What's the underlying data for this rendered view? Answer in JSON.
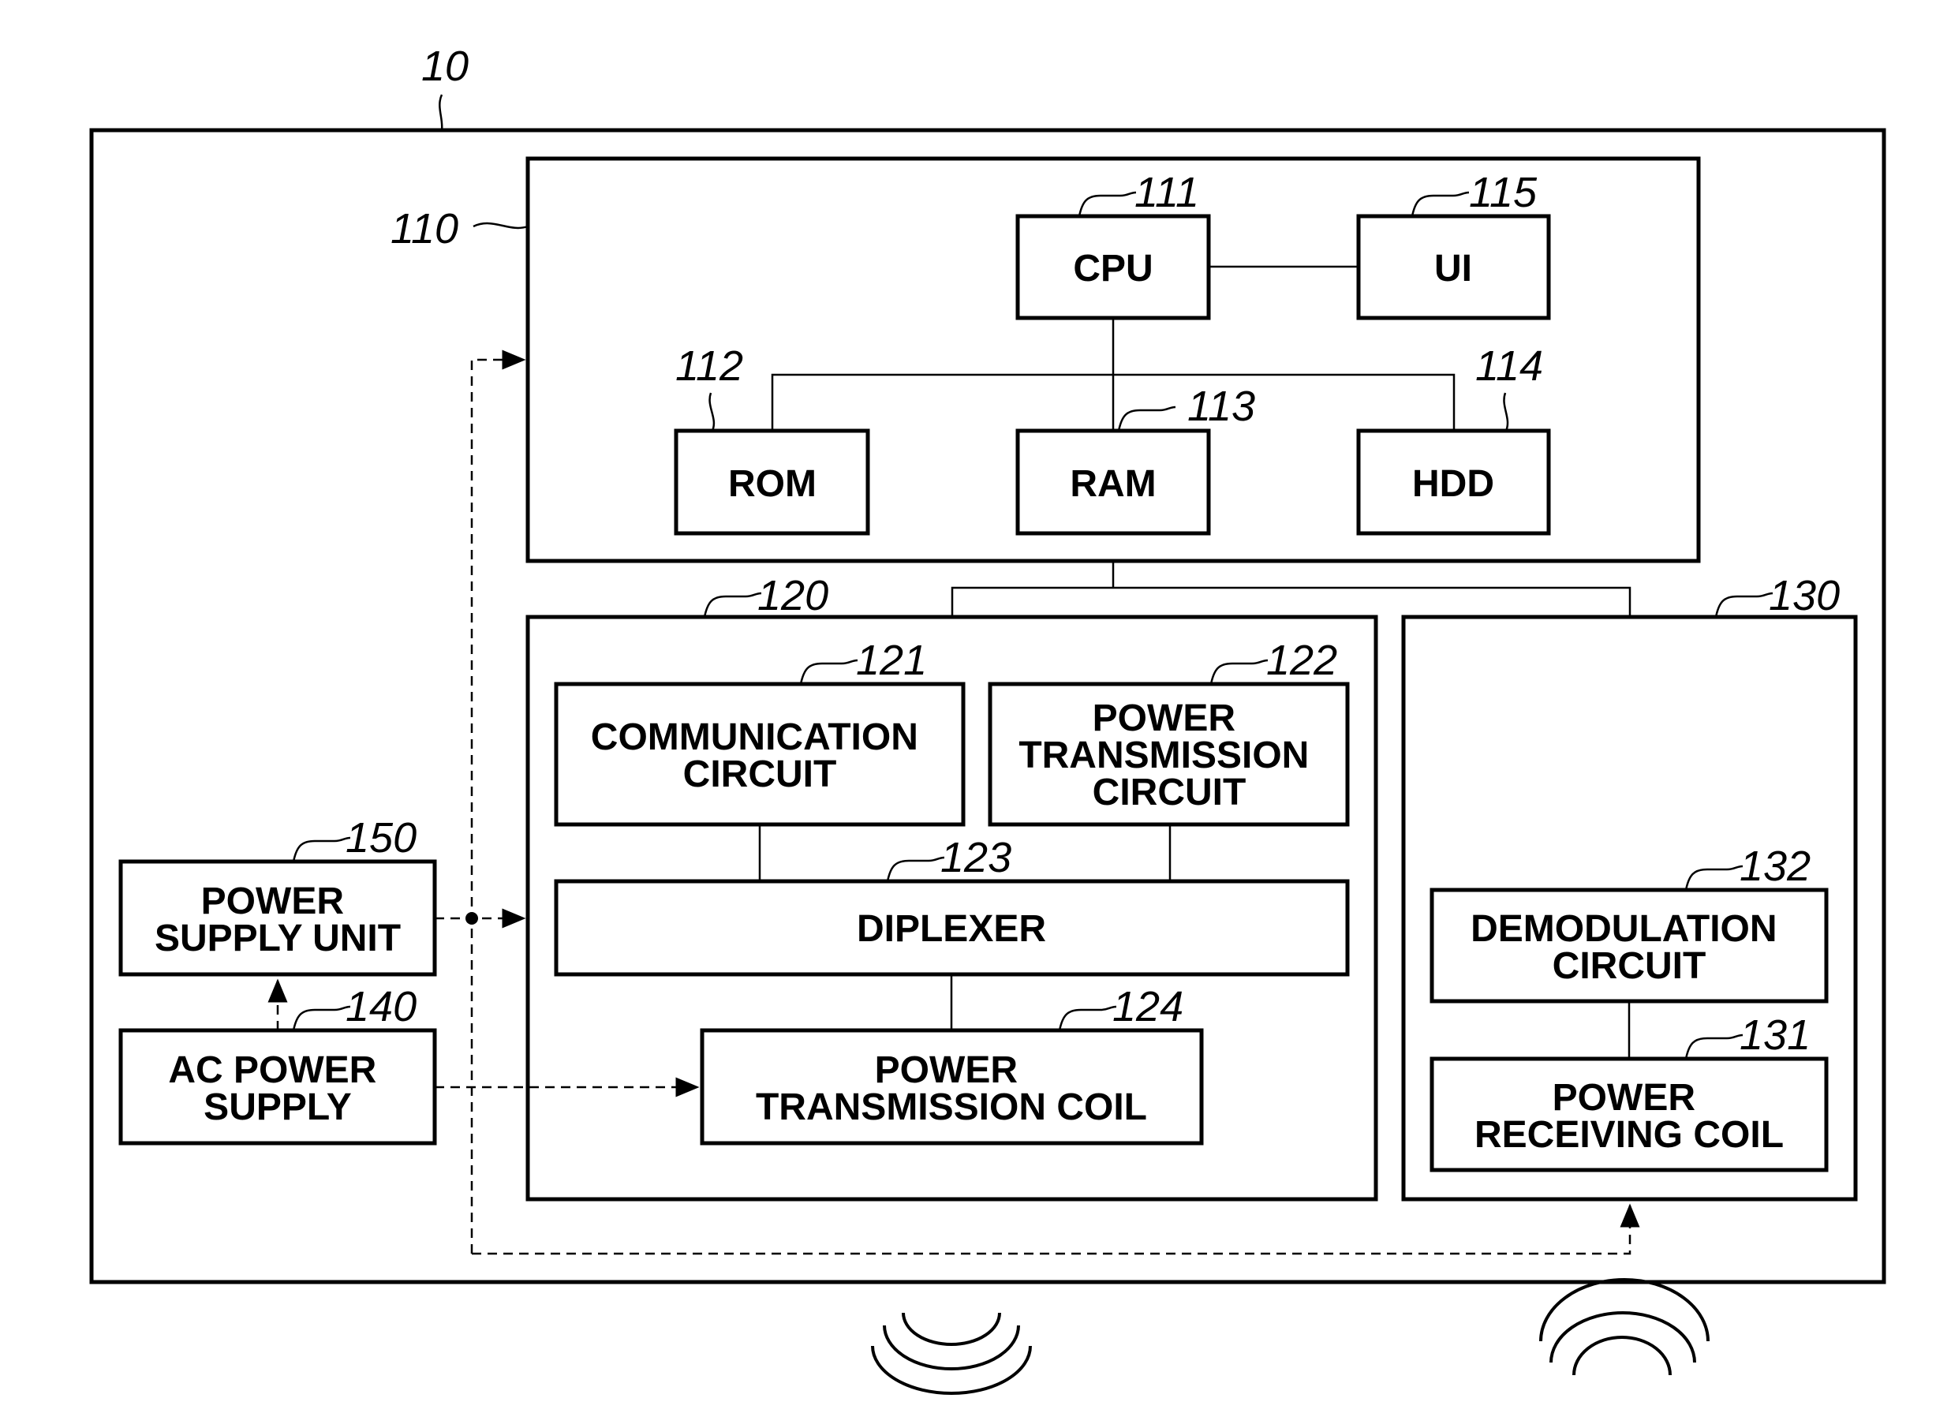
{
  "figure": {
    "device_ref": "10",
    "control": {
      "ref": "110",
      "cpu": {
        "ref": "111",
        "label": "CPU"
      },
      "rom": {
        "ref": "112",
        "label": "ROM"
      },
      "ram": {
        "ref": "113",
        "label": "RAM"
      },
      "hdd": {
        "ref": "114",
        "label": "HDD"
      },
      "ui": {
        "ref": "115",
        "label": "UI"
      }
    },
    "transmitter": {
      "ref": "120",
      "communication_circuit": {
        "ref": "121",
        "lines": [
          "COMMUNICATION",
          "CIRCUIT"
        ]
      },
      "power_transmission_circuit": {
        "ref": "122",
        "lines": [
          "POWER",
          "TRANSMISSION",
          "CIRCUIT"
        ]
      },
      "diplexer": {
        "ref": "123",
        "label": "DIPLEXER"
      },
      "power_transmission_coil": {
        "ref": "124",
        "lines": [
          "POWER",
          "TRANSMISSION COIL"
        ]
      }
    },
    "receiver": {
      "ref": "130",
      "power_receiving_coil": {
        "ref": "131",
        "lines": [
          "POWER",
          "RECEIVING COIL"
        ]
      },
      "demodulation_circuit": {
        "ref": "132",
        "lines": [
          "DEMODULATION",
          "CIRCUIT"
        ]
      }
    },
    "ac_power_supply": {
      "ref": "140",
      "lines": [
        "AC POWER",
        "SUPPLY"
      ]
    },
    "power_supply_unit": {
      "ref": "150",
      "lines": [
        "POWER",
        "SUPPLY UNIT"
      ]
    },
    "icons": {
      "transmit_waves": "wireless-transmit-icon",
      "receive_waves": "wireless-receive-icon"
    }
  }
}
